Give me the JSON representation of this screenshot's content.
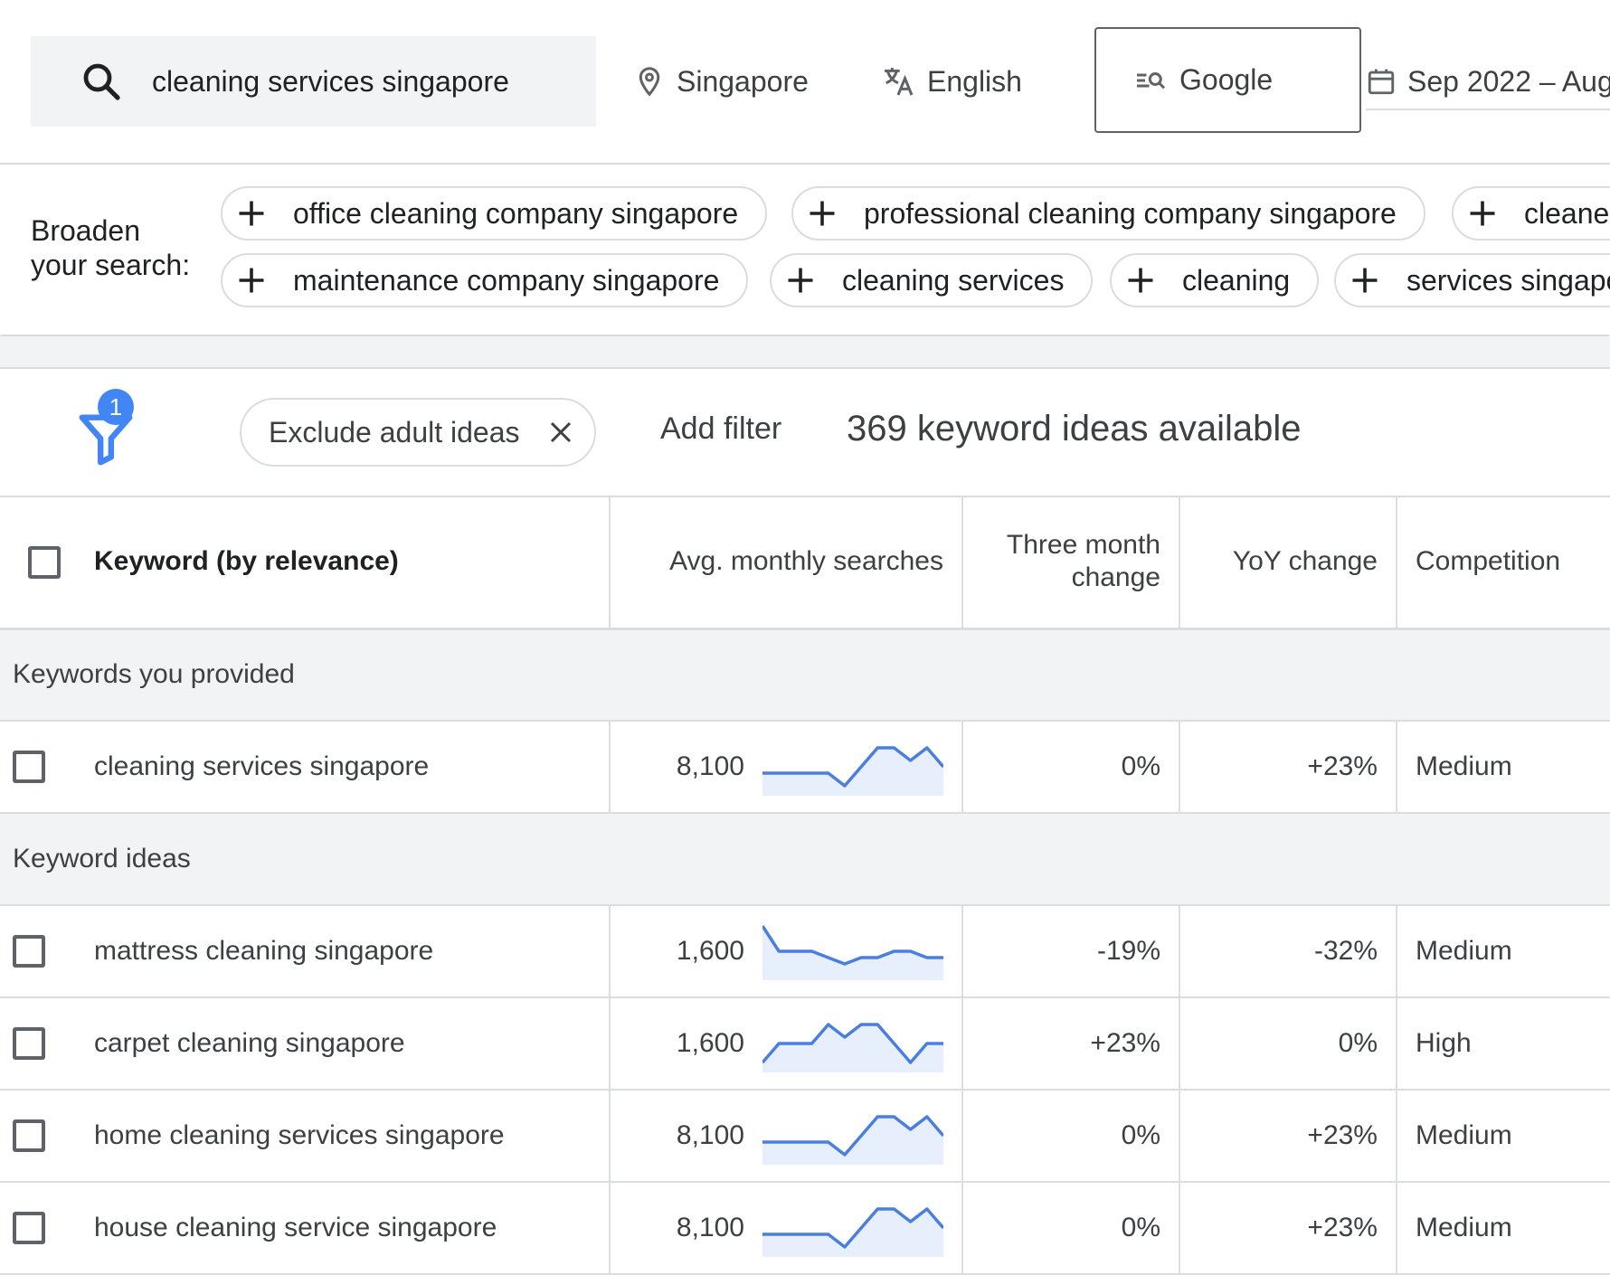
{
  "search": {
    "query": "cleaning services singapore"
  },
  "location": "Singapore",
  "language": "English",
  "engine": "Google",
  "date_range": "Sep 2022 – Aug",
  "broaden": {
    "label": "Broaden your search:",
    "row1": [
      "office cleaning company singapore",
      "professional cleaning company singapore",
      "cleaner"
    ],
    "row2": [
      "maintenance company singapore",
      "cleaning services",
      "cleaning",
      "services singapo"
    ]
  },
  "filters": {
    "badge_count": "1",
    "active_filter": "Exclude adult ideas",
    "add_filter": "Add filter",
    "ideas_count": "369 keyword ideas available"
  },
  "table": {
    "headers": {
      "keyword": "Keyword (by relevance)",
      "avg": "Avg. monthly searches",
      "three_month": "Three month change",
      "yoy": "YoY change",
      "competition": "Competition"
    },
    "groups": [
      {
        "title": "Keywords you provided",
        "rows": [
          {
            "keyword": "cleaning services singapore",
            "avg": "8,100",
            "three_month": "0%",
            "yoy": "+23%",
            "competition": "Medium",
            "trend": [
              3,
              3,
              3,
              3,
              3,
              1,
              4,
              7,
              7,
              5,
              7,
              4
            ]
          }
        ]
      },
      {
        "title": "Keyword ideas",
        "rows": [
          {
            "keyword": "mattress cleaning singapore",
            "avg": "1,600",
            "three_month": "-19%",
            "yoy": "-32%",
            "competition": "Medium",
            "trend": [
              8,
              4,
              4,
              4,
              3,
              2,
              3,
              3,
              4,
              4,
              3,
              3
            ]
          },
          {
            "keyword": "carpet cleaning singapore",
            "avg": "1,600",
            "three_month": "+23%",
            "yoy": "0%",
            "competition": "High",
            "trend": [
              1,
              4,
              4,
              4,
              7,
              5,
              7,
              7,
              4,
              1,
              4,
              4
            ]
          },
          {
            "keyword": "home cleaning services singapore",
            "avg": "8,100",
            "three_month": "0%",
            "yoy": "+23%",
            "competition": "Medium",
            "trend": [
              3,
              3,
              3,
              3,
              3,
              1,
              4,
              7,
              7,
              5,
              7,
              4
            ]
          },
          {
            "keyword": "house cleaning service singapore",
            "avg": "8,100",
            "three_month": "0%",
            "yoy": "+23%",
            "competition": "Medium",
            "trend": [
              3,
              3,
              3,
              3,
              3,
              1,
              4,
              7,
              7,
              5,
              7,
              4
            ]
          }
        ]
      }
    ]
  },
  "colors": {
    "accent": "#4285f4",
    "spark_line": "#4a7fe0",
    "spark_fill": "#e8effc"
  }
}
